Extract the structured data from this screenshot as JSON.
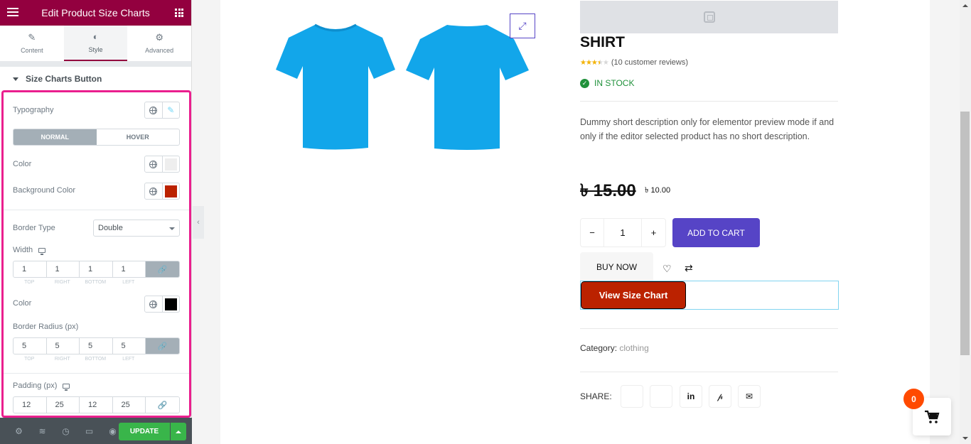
{
  "panel": {
    "title": "Edit Product Size Charts",
    "tabs": [
      {
        "label": "Content",
        "icon": "pencil-icon"
      },
      {
        "label": "Style",
        "icon": "contrast-icon",
        "active": true
      },
      {
        "label": "Advanced",
        "icon": "gear-icon"
      }
    ],
    "section": "Size Charts Button",
    "typography_label": "Typography",
    "state_tabs": [
      "NORMAL",
      "HOVER"
    ],
    "color_label": "Color",
    "color_value": "#eeeeee",
    "bg_color_label": "Background Color",
    "bg_color_value": "#bb2200",
    "border_type_label": "Border Type",
    "border_type_value": "Double",
    "width_label": "Width",
    "width_values": [
      "1",
      "1",
      "1",
      "1"
    ],
    "dim_labels": [
      "TOP",
      "RIGHT",
      "BOTTOM",
      "LEFT"
    ],
    "border_color_label": "Color",
    "border_color_value": "#000000",
    "radius_label": "Border Radius (px)",
    "radius_values": [
      "5",
      "5",
      "5",
      "5"
    ],
    "padding_label": "Padding (px)",
    "padding_values": [
      "12",
      "25",
      "12",
      "25"
    ],
    "update_label": "UPDATE"
  },
  "product": {
    "title": "SHIRT",
    "rating": 3.5,
    "rating_max": 5,
    "reviews": "(10 customer reviews)",
    "stock": "IN STOCK",
    "description": "Dummy short description only for elementor preview mode if and only if the editor selected product has no short description.",
    "price_old": "৳ 15.00",
    "price_new": "৳ 10.00",
    "quantity": "1",
    "add_to_cart": "ADD TO CART",
    "buy_now": "BUY NOW",
    "size_chart_button": "View Size Chart",
    "category_label": "Category:",
    "category_value": "clothing",
    "share_label": "SHARE:",
    "cart_count": "0"
  },
  "colors": {
    "brand": "#93003f",
    "accent": "#5644c6",
    "highlight": "#ea1f8e",
    "update": "#39b54a",
    "stock": "#20913b"
  }
}
